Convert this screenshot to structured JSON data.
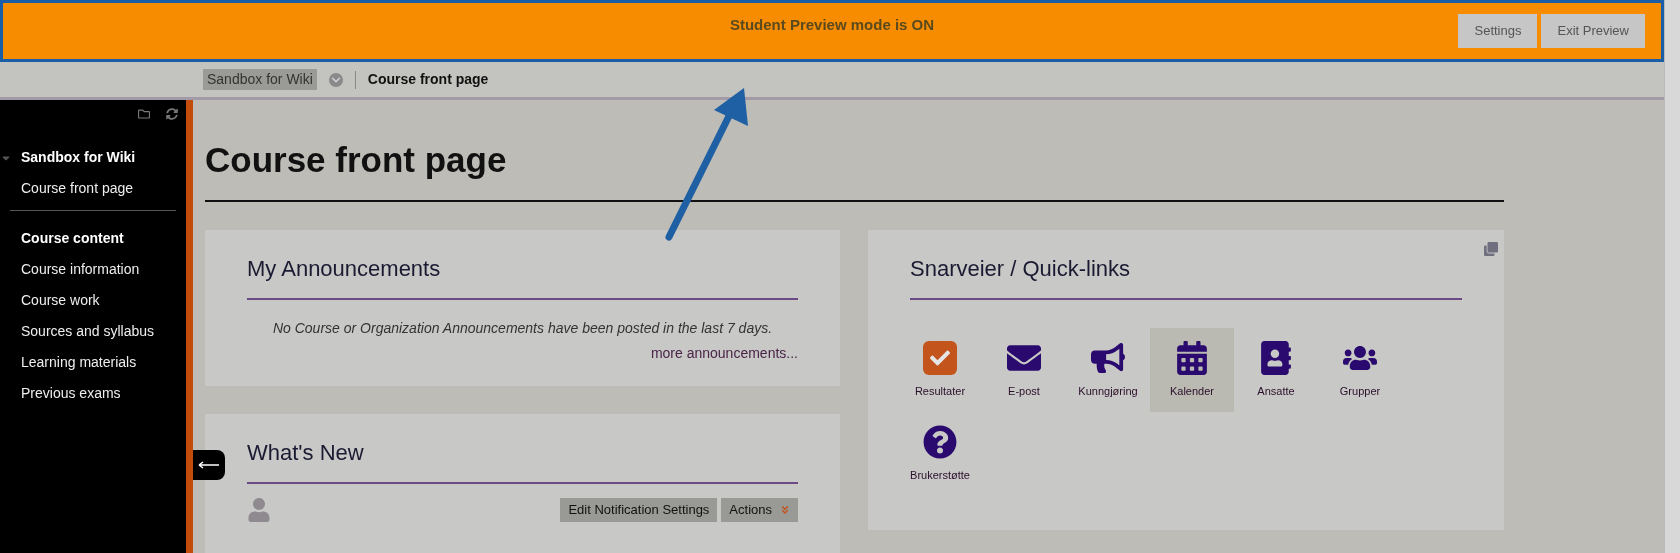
{
  "preview_banner": {
    "message": "Student Preview mode is ON",
    "buttons": [
      "Settings",
      "Exit Preview"
    ]
  },
  "breadcrumb": [
    {
      "label": "Sandbox for Wiki",
      "selected": true
    },
    {
      "label": "Course front page",
      "selected": false
    }
  ],
  "sidebar": {
    "groups": [
      {
        "heading": "Sandbox for Wiki",
        "expanded": true,
        "items": [
          "Course front page"
        ]
      },
      {
        "heading": "Course content",
        "items": [
          "Course information",
          "Course work",
          "Sources and syllabus",
          "Learning materials",
          "Previous exams"
        ]
      }
    ]
  },
  "page_title": "Course front page",
  "announcements": {
    "title": "My Announcements",
    "message": "No Course or Organization Announcements have been posted in the last 7 days.",
    "link": "more announcements..."
  },
  "whats_new": {
    "title": "What's New",
    "buttons": [
      "Edit Notification Settings",
      "Actions"
    ]
  },
  "quick_links": {
    "title": "Snarveier / Quick-links",
    "items": [
      {
        "label": "Resultater",
        "selected": false
      },
      {
        "label": "E-post",
        "selected": false
      },
      {
        "label": "Kunngjøring",
        "selected": false
      },
      {
        "label": "Kalender",
        "selected": true
      },
      {
        "label": "Ansatte",
        "selected": false
      },
      {
        "label": "Grupper",
        "selected": false
      },
      {
        "label": "Brukerstøtte",
        "selected": false
      }
    ]
  }
}
